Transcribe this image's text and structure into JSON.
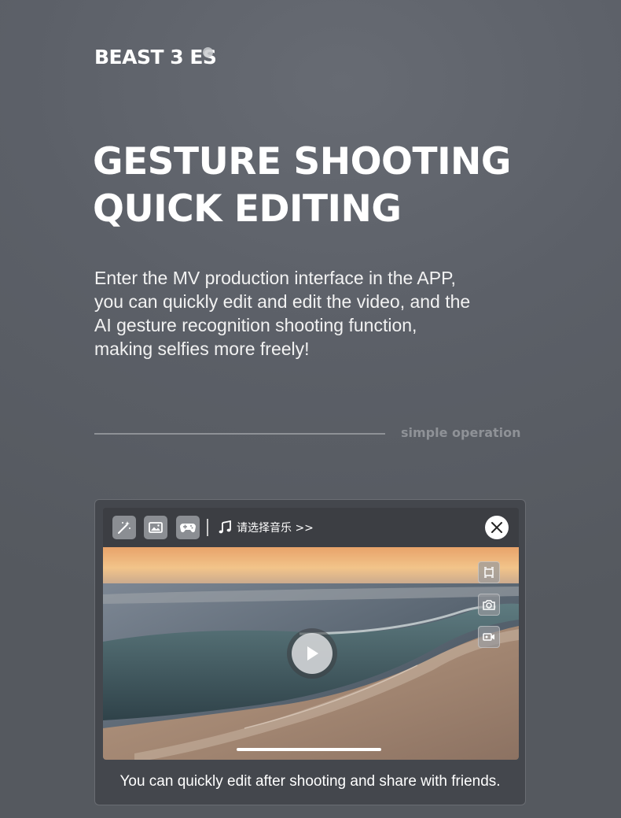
{
  "brand": {
    "name": "BEAST 3 ES"
  },
  "headline": {
    "line1": "GESTURE SHOOTING",
    "line2": "QUICK EDITING"
  },
  "description": {
    "line1": "Enter the MV production interface in the APP,",
    "line2": "you can quickly edit and edit the video, and the",
    "line3": "AI gesture recognition shooting function,",
    "line4": "making selfies more freely!"
  },
  "divider": {
    "label": "simple operation"
  },
  "app_preview": {
    "toolbar": {
      "icons": [
        "magic-wand-icon",
        "image-icon",
        "gamepad-icon"
      ],
      "music_icon": "music-note-icon",
      "music_label": "请选择音乐 >>",
      "close_icon": "close-icon"
    },
    "side_buttons": [
      "screen-rotate-icon",
      "camera-icon",
      "video-camera-icon"
    ],
    "play_icon": "play-icon",
    "caption": "You can quickly edit after shooting and share with friends."
  },
  "colors": {
    "background": "#5c6068",
    "card": "#44474d",
    "divider": "#8e9196",
    "text": "#ffffff"
  }
}
